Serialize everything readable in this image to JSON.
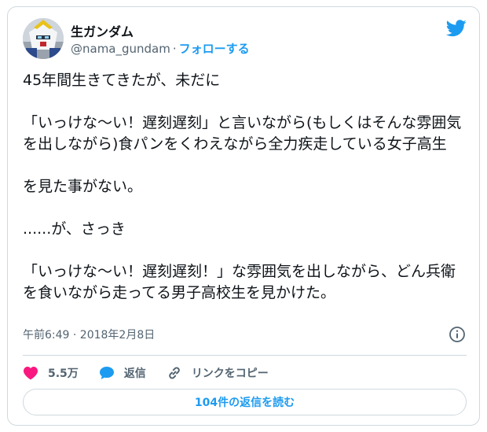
{
  "user": {
    "display_name": "生ガンダム",
    "handle": "@nama_gundam",
    "separator": "·",
    "follow_label": "フォローする"
  },
  "tweet": {
    "text": "45年間生きてきたが、未だに\n\n「いっけな〜い！遅刻遅刻」と言いながら(もしくはそんな雰囲気を出しながら)食パンをくわえながら全力疾走している女子高生\n\nを見た事がない。\n\n......が、さっき\n\n「いっけな〜い！遅刻遅刻！」な雰囲気を出しながら、どん兵衛を食いながら走ってる男子高校生を見かけた。",
    "timestamp": "午前6:49 · 2018年2月8日"
  },
  "actions": {
    "like_count": "5.5万",
    "reply_label": "返信",
    "copy_link_label": "リンクをコピー"
  },
  "read_replies_label": "104件の返信を読む",
  "icons": {
    "avatar": "gundam-avatar",
    "brand": "twitter-bird-icon",
    "info": "info-icon",
    "like": "heart-icon",
    "reply": "speech-bubble-icon",
    "link": "link-icon"
  },
  "colors": {
    "accent": "#1d9bf0",
    "like": "#f91880",
    "text": "#0f1419",
    "muted": "#536471",
    "border": "#cfd9de"
  }
}
